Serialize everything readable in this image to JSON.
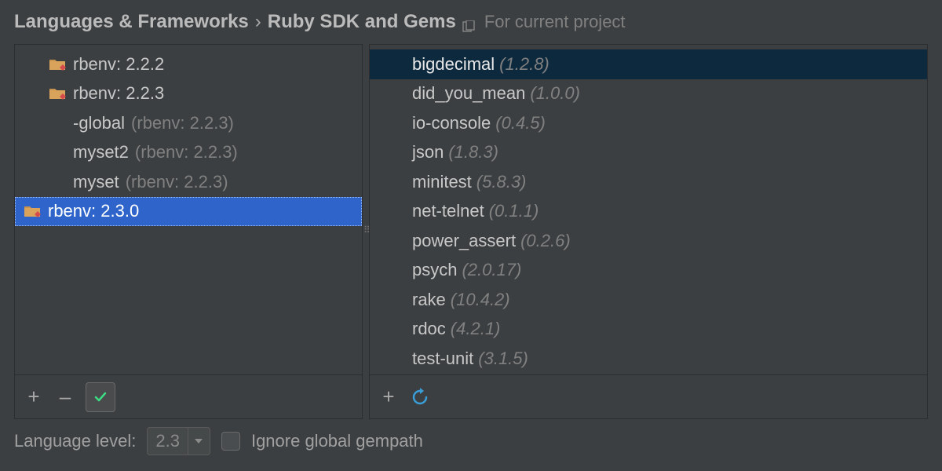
{
  "breadcrumb": {
    "parent": "Languages & Frameworks",
    "separator": "›",
    "title": "Ruby SDK and Gems",
    "scope": "For current project"
  },
  "sdks": [
    {
      "label": "rbenv: 2.2.2",
      "hasIcon": true,
      "indent": false,
      "secondary": "",
      "selected": false
    },
    {
      "label": "rbenv: 2.2.3",
      "hasIcon": true,
      "indent": false,
      "secondary": "",
      "selected": false
    },
    {
      "label": "-global",
      "hasIcon": false,
      "indent": true,
      "secondary": "(rbenv: 2.2.3)",
      "selected": false
    },
    {
      "label": "myset2",
      "hasIcon": false,
      "indent": true,
      "secondary": "(rbenv: 2.2.3)",
      "selected": false
    },
    {
      "label": "myset",
      "hasIcon": false,
      "indent": true,
      "secondary": "(rbenv: 2.2.3)",
      "selected": false
    },
    {
      "label": "rbenv: 2.3.0",
      "hasIcon": true,
      "indent": false,
      "secondary": "",
      "selected": true
    }
  ],
  "gems": [
    {
      "name": "bigdecimal",
      "version": "(1.2.8)",
      "selected": true
    },
    {
      "name": "did_you_mean",
      "version": "(1.0.0)",
      "selected": false
    },
    {
      "name": "io-console",
      "version": "(0.4.5)",
      "selected": false
    },
    {
      "name": "json",
      "version": "(1.8.3)",
      "selected": false
    },
    {
      "name": "minitest",
      "version": "(5.8.3)",
      "selected": false
    },
    {
      "name": "net-telnet",
      "version": "(0.1.1)",
      "selected": false
    },
    {
      "name": "power_assert",
      "version": "(0.2.6)",
      "selected": false
    },
    {
      "name": "psych",
      "version": "(2.0.17)",
      "selected": false
    },
    {
      "name": "rake",
      "version": "(10.4.2)",
      "selected": false
    },
    {
      "name": "rdoc",
      "version": "(4.2.1)",
      "selected": false
    },
    {
      "name": "test-unit",
      "version": "(3.1.5)",
      "selected": false
    }
  ],
  "leftToolbar": {
    "add": "+",
    "remove": "–"
  },
  "rightToolbar": {
    "add": "+"
  },
  "footer": {
    "langLabel": "Language level:",
    "langValue": "2.3",
    "ignoreLabel": "Ignore global gempath"
  }
}
